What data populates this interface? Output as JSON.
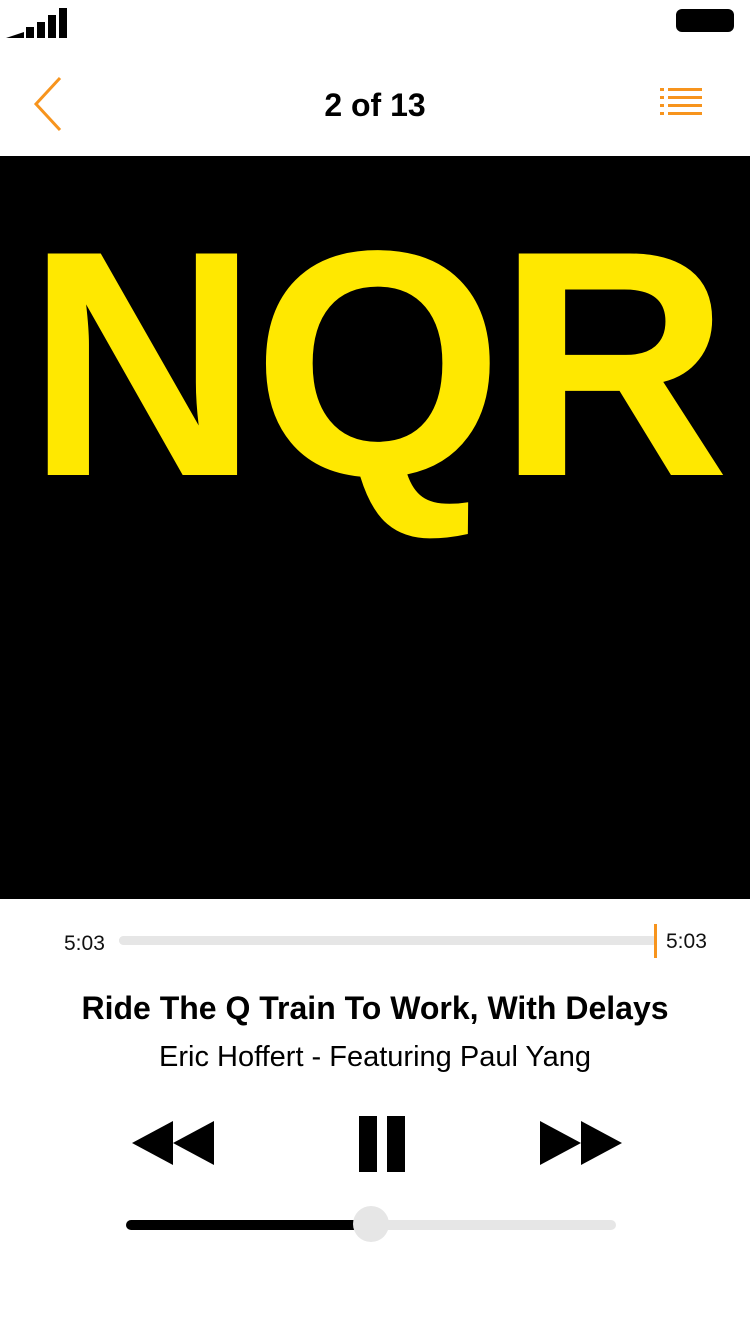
{
  "header": {
    "title": "2 of 13",
    "back_icon": "chevron-left-icon",
    "queue_icon": "list-icon"
  },
  "album_art": {
    "text": "NQR",
    "background_color": "#000000",
    "text_color": "#ffe800"
  },
  "playback": {
    "elapsed": "5:03",
    "total": "5:03",
    "progress_fraction": 1.0
  },
  "track": {
    "title": "Ride The Q Train To Work, With Delays",
    "artist": "Eric Hoffert - Featuring Paul Yang"
  },
  "controls": {
    "rewind_icon": "rewind-icon",
    "pause_icon": "pause-icon",
    "forward_icon": "fast-forward-icon"
  },
  "volume": {
    "level_fraction": 0.5
  },
  "colors": {
    "accent": "#f7941d",
    "track_bg": "#e6e6e6"
  }
}
